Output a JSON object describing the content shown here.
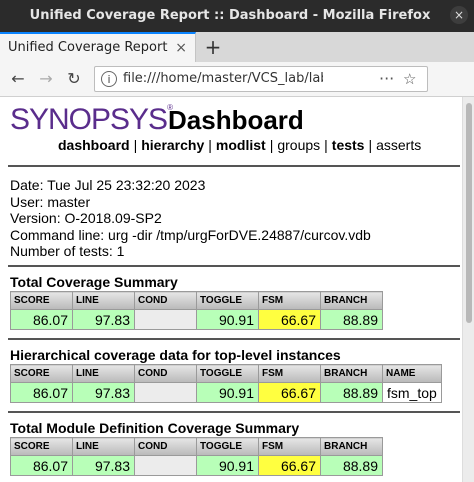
{
  "window": {
    "title": "Unified Coverage Report :: Dashboard - Mozilla Firefox",
    "close_glyph": "×"
  },
  "tab": {
    "label": "Unified Coverage Report :: Da",
    "close_glyph": "×",
    "new_tab_glyph": "+"
  },
  "nav": {
    "back_glyph": "←",
    "forward_glyph": "→",
    "reload_glyph": "↻",
    "info_glyph": "i",
    "url": "file:///home/master/VCS_lab/lab",
    "more_glyph": "···",
    "star_glyph": "☆"
  },
  "page": {
    "logo_text": "SYNOPSYS",
    "logo_mark": "®",
    "title": "Dashboard",
    "menu": {
      "dashboard": "dashboard",
      "hierarchy": "hierarchy",
      "modlist": "modlist",
      "groups": "groups",
      "tests": "tests",
      "asserts": "asserts",
      "separator": "|"
    },
    "info": {
      "date": "Date: Tue Jul 25 23:32:20 2023",
      "user": "User: master",
      "version": "Version: O-2018.09-SP2",
      "command": "Command line: urg -dir /tmp/urgForDVE.24887/curcov.vdb",
      "num_tests": "Number of tests: 1"
    },
    "sections": {
      "total": {
        "title": "Total Coverage Summary",
        "headers": [
          "SCORE",
          "LINE",
          "COND",
          "TOGGLE",
          "FSM",
          "BRANCH"
        ],
        "values": [
          "86.07",
          "97.83",
          "",
          "90.91",
          "66.67",
          "88.89"
        ]
      },
      "hier": {
        "title": "Hierarchical coverage data for top-level instances",
        "headers": [
          "SCORE",
          "LINE",
          "COND",
          "TOGGLE",
          "FSM",
          "BRANCH",
          "NAME"
        ],
        "values": [
          "86.07",
          "97.83",
          "",
          "90.91",
          "66.67",
          "88.89",
          "fsm_top"
        ]
      },
      "module": {
        "title": "Total Module Definition Coverage Summary",
        "headers": [
          "SCORE",
          "LINE",
          "COND",
          "TOGGLE",
          "FSM",
          "BRANCH"
        ],
        "values": [
          "86.07",
          "97.83",
          "",
          "90.91",
          "66.67",
          "88.89"
        ]
      }
    }
  },
  "colors": {
    "good": "#b8ffb8",
    "warn": "#ffff40",
    "empty": "#ececec",
    "brand": "#5a2d8c"
  }
}
